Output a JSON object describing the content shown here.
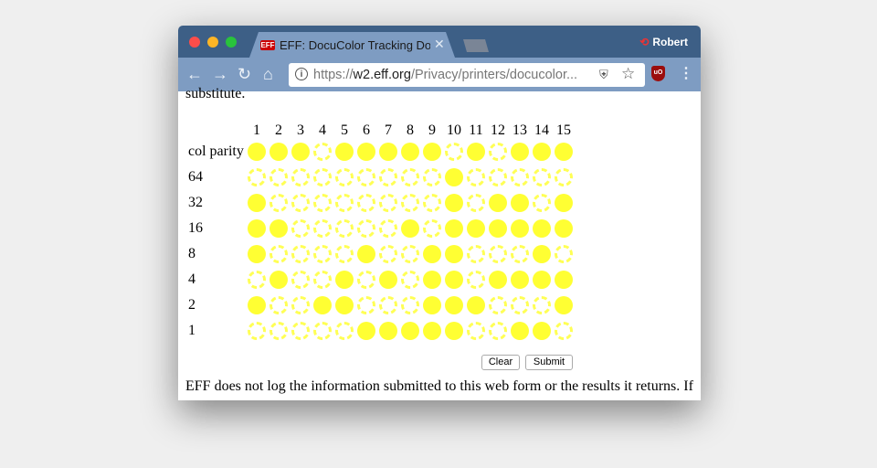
{
  "browser": {
    "tab_title": "EFF: DocuColor Tracking Dot Decoding Guide",
    "tab_icon_text": "EFF",
    "profile_name": "Robert",
    "url_scheme": "https://",
    "url_host": "w2.eff.org",
    "url_path": "/Privacy/printers/docucolor...",
    "ublock_text": "uO"
  },
  "page": {
    "top_text": "substitute.",
    "column_headers": [
      "1",
      "2",
      "3",
      "4",
      "5",
      "6",
      "7",
      "8",
      "9",
      "10",
      "11",
      "12",
      "13",
      "14",
      "15"
    ],
    "rows": [
      {
        "label": "col parity",
        "dots": [
          1,
          1,
          1,
          0,
          1,
          1,
          1,
          1,
          1,
          0,
          1,
          0,
          1,
          1,
          1
        ]
      },
      {
        "label": "64",
        "dots": [
          0,
          0,
          0,
          0,
          0,
          0,
          0,
          0,
          0,
          1,
          0,
          0,
          0,
          0,
          0
        ]
      },
      {
        "label": "32",
        "dots": [
          1,
          0,
          0,
          0,
          0,
          0,
          0,
          0,
          0,
          1,
          0,
          1,
          1,
          0,
          1
        ]
      },
      {
        "label": "16",
        "dots": [
          1,
          1,
          0,
          0,
          0,
          0,
          0,
          1,
          0,
          1,
          1,
          1,
          1,
          1,
          1
        ]
      },
      {
        "label": "8",
        "dots": [
          1,
          0,
          0,
          0,
          0,
          1,
          0,
          0,
          1,
          1,
          0,
          0,
          0,
          1,
          0
        ]
      },
      {
        "label": "4",
        "dots": [
          0,
          1,
          0,
          0,
          1,
          0,
          1,
          0,
          1,
          1,
          0,
          1,
          1,
          1,
          1
        ]
      },
      {
        "label": "2",
        "dots": [
          1,
          0,
          0,
          1,
          1,
          0,
          0,
          0,
          1,
          1,
          1,
          0,
          0,
          0,
          1
        ]
      },
      {
        "label": "1",
        "dots": [
          0,
          0,
          0,
          0,
          0,
          1,
          1,
          1,
          1,
          1,
          0,
          0,
          1,
          1,
          0
        ]
      }
    ],
    "clear_label": "Clear",
    "submit_label": "Submit",
    "bottom_text": "EFF does not log the information submitted to this web form or the results it returns. If"
  },
  "colors": {
    "dot": "#ffff33",
    "tabbar": "#3d5f86",
    "toolbar": "#7e9cc2"
  }
}
